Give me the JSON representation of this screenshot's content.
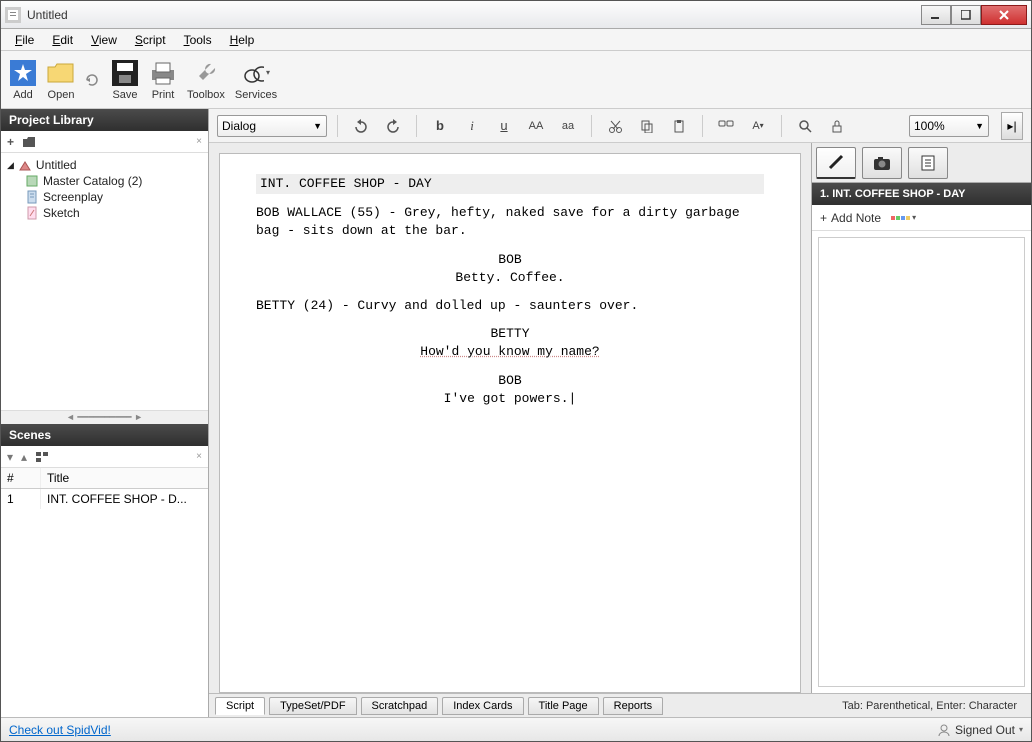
{
  "window": {
    "title": "Untitled"
  },
  "menu": {
    "file": "File",
    "edit": "Edit",
    "view": "View",
    "script": "Script",
    "tools": "Tools",
    "help": "Help"
  },
  "toolbar": {
    "add": "Add",
    "open": "Open",
    "save": "Save",
    "print": "Print",
    "toolbox": "Toolbox",
    "services": "Services"
  },
  "project_library": {
    "title": "Project Library",
    "root": "Untitled",
    "items": [
      {
        "label": "Master Catalog (2)"
      },
      {
        "label": "Screenplay"
      },
      {
        "label": "Sketch"
      }
    ]
  },
  "scenes": {
    "title": "Scenes",
    "col_num": "#",
    "col_title": "Title",
    "rows": [
      {
        "num": "1",
        "title": "INT. COFFEE SHOP - D..."
      }
    ]
  },
  "editor": {
    "element_style": "Dialog",
    "zoom": "100%",
    "slug": "INT. COFFEE SHOP - DAY",
    "action1": "BOB WALLACE (55) - Grey, hefty, naked save for a dirty garbage bag - sits down at the bar.",
    "char1": "BOB",
    "dialog1": "Betty.  Coffee.",
    "action2": "BETTY (24) - Curvy and dolled up - saunters over.",
    "char2": "BETTY",
    "dialog2": "How'd you know my name?",
    "char3": "BOB",
    "dialog3": "I've got powers."
  },
  "right_panel": {
    "scene_title": "1. INT. COFFEE SHOP - DAY",
    "add_note": "Add Note"
  },
  "bottom_tabs": {
    "script": "Script",
    "typeset": "TypeSet/PDF",
    "scratch": "Scratchpad",
    "cards": "Index Cards",
    "titlepage": "Title Page",
    "reports": "Reports",
    "hint": "Tab: Parenthetical, Enter: Character"
  },
  "status": {
    "link": "Check out SpidVid!",
    "signed": "Signed Out"
  }
}
